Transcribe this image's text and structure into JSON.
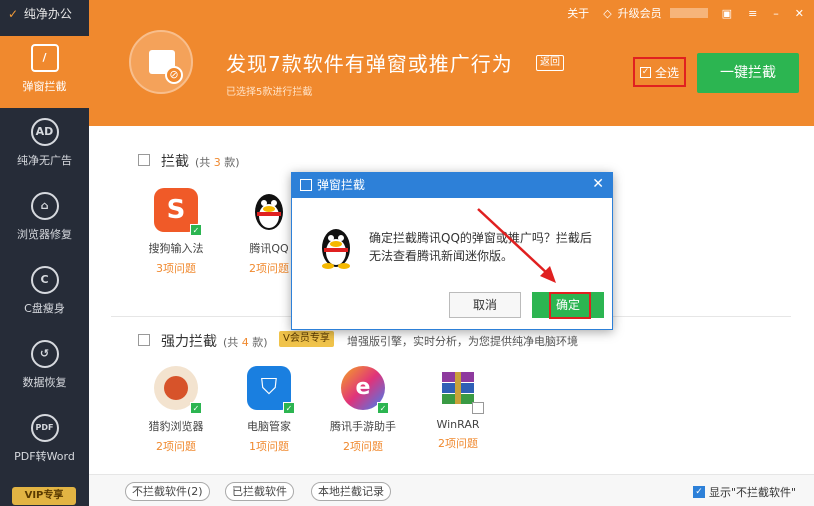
{
  "app": {
    "title": "纯净办公"
  },
  "sidebar": {
    "items": [
      {
        "label": "弹窗拦截",
        "icon": "popup-block-icon",
        "glyph": "/"
      },
      {
        "label": "纯净无广告",
        "icon": "no-ad-icon",
        "glyph": "AD"
      },
      {
        "label": "浏览器修复",
        "icon": "browser-repair-icon",
        "glyph": "⌂"
      },
      {
        "label": "C盘瘦身",
        "icon": "disk-slim-icon",
        "glyph": "C"
      },
      {
        "label": "数据恢复",
        "icon": "data-recover-icon",
        "glyph": "↺"
      },
      {
        "label": "PDF转Word",
        "icon": "pdf-icon",
        "glyph": "PDF"
      }
    ],
    "vip_badge": "VIP专享"
  },
  "topbar": {
    "about": "关于",
    "upgrade": "升级会员"
  },
  "hero": {
    "title": "发现7款软件有弹窗或推广行为",
    "back": "返回",
    "subtitle": "已选择5款进行拦截",
    "select_all": "全选",
    "block_all": "一键拦截"
  },
  "section1": {
    "title": "拦截",
    "count_prefix": "(共",
    "count": "3",
    "count_suffix": "款)",
    "apps": [
      {
        "name": "搜狗输入法",
        "issues": "3项问题"
      },
      {
        "name": "腾讯QQ",
        "issues": "2项问题"
      }
    ]
  },
  "section2": {
    "title": "强力拦截",
    "count_prefix": "(共",
    "count": "4",
    "count_suffix": "款)",
    "vip": "V会员专享",
    "desc": "增强版引擎，实时分析，为您提供纯净电脑环境",
    "apps": [
      {
        "name": "猎豹浏览器",
        "issues": "2项问题"
      },
      {
        "name": "电脑管家",
        "issues": "1项问题"
      },
      {
        "name": "腾讯手游助手",
        "issues": "2项问题"
      },
      {
        "name": "WinRAR",
        "issues": "2项问题"
      }
    ]
  },
  "bottom": {
    "not_blocked": "不拦截软件(2)",
    "blocked": "已拦截软件",
    "local_records": "本地拦截记录",
    "show_unblocked": "显示\"不拦截软件\""
  },
  "dialog": {
    "title": "弹窗拦截",
    "message": "确定拦截腾讯QQ的弹窗或推广吗？拦截后无法查看腾讯新闻迷你版。",
    "cancel": "取消",
    "ok": "确定"
  },
  "colors": {
    "accent": "#f0892e",
    "sidebar": "#262c38",
    "green": "#2cb551",
    "blue": "#2d80d8",
    "highlight": "#e02020"
  }
}
